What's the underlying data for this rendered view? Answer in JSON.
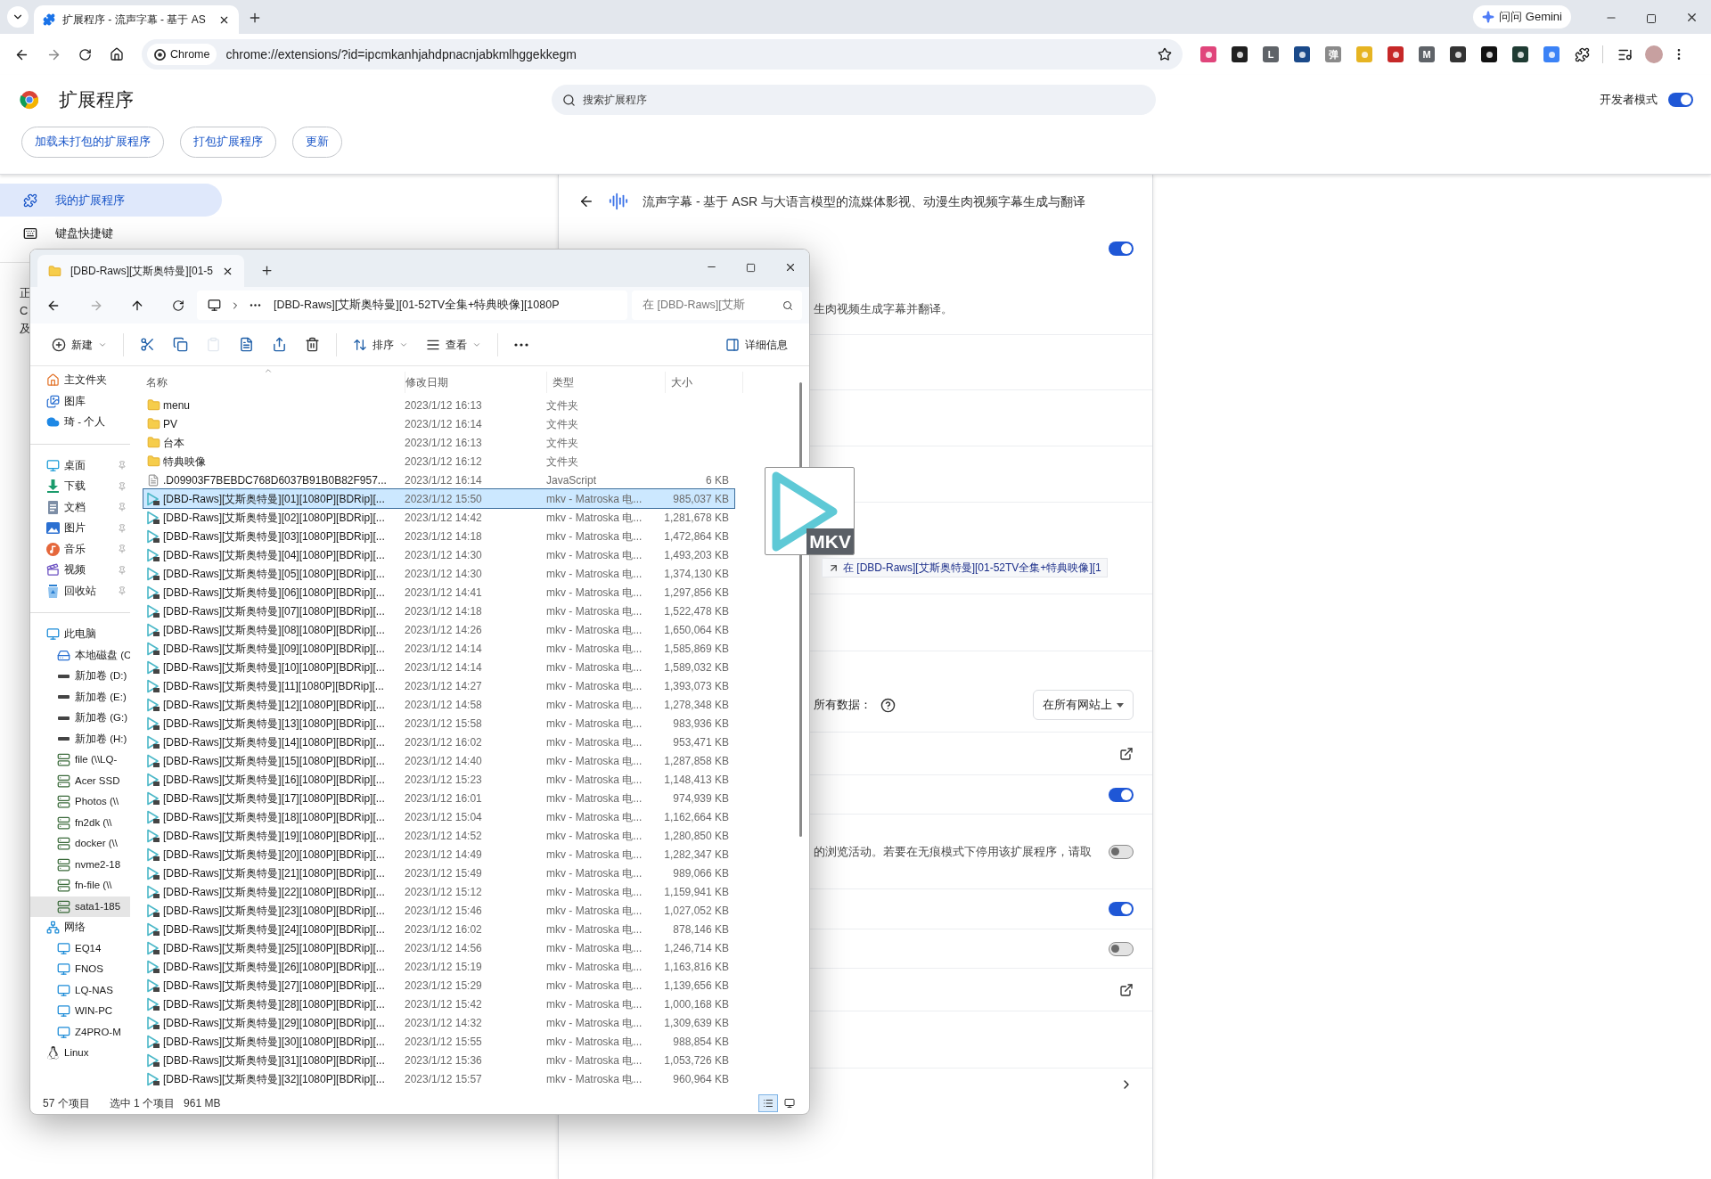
{
  "browser": {
    "tab_title": "扩展程序 - 流声字幕 - 基于 AS",
    "gemini_button": "问问 Gemini",
    "url_chip": "Chrome",
    "url": "chrome://extensions/?id=ipcmkanhjahdpnacnjabkmlhggekkegm",
    "extension_icons": [
      {
        "color": "#e0457b"
      },
      {
        "color": "#1f1f1f"
      },
      {
        "color": "#5f6368",
        "label": "L"
      },
      {
        "color": "#1b4a8a"
      },
      {
        "color": "#8a8a8a",
        "label": "弹"
      },
      {
        "color": "#e6b422"
      },
      {
        "color": "#c62828"
      },
      {
        "color": "#5f6368",
        "label": "M"
      },
      {
        "color": "#333333"
      },
      {
        "color": "#111111"
      },
      {
        "color": "#1f3b33"
      },
      {
        "color": "#3b82f6"
      }
    ]
  },
  "extensions_page": {
    "title": "扩展程序",
    "search_placeholder": "搜索扩展程序",
    "developer_mode": {
      "label": "开发者模式",
      "on": true
    },
    "actions": [
      "加载未打包的扩展程序",
      "打包扩展程序",
      "更新"
    ],
    "sidebar": [
      {
        "label": "我的扩展程序",
        "selected": true
      },
      {
        "label": "键盘快捷键",
        "selected": false
      }
    ],
    "sidebar_fragments": [
      "正",
      "C",
      "及"
    ],
    "detail": {
      "title": "流声字幕 - 基于 ASR 与大语言模型的流媒体影视、动漫生肉视频字幕生成与翻译",
      "rows": [
        {
          "kind": "toggle_desc",
          "on": true,
          "text": "生肉视频生成字幕并翻译。"
        },
        {
          "kind": "blank"
        },
        {
          "kind": "blank"
        },
        {
          "kind": "blank"
        },
        {
          "kind": "blank"
        },
        {
          "kind": "blank"
        },
        {
          "kind": "site_access",
          "text": "所有数据：",
          "dropdown": "在所有网站上"
        },
        {
          "kind": "link"
        },
        {
          "kind": "toggle",
          "on": true
        },
        {
          "kind": "toggle_text",
          "on": false,
          "text": "的浏览活动。若要在无痕模式下停用该扩展程序，请取"
        },
        {
          "kind": "toggle",
          "on": true
        },
        {
          "kind": "toggle",
          "on": false
        },
        {
          "kind": "link"
        },
        {
          "kind": "blank"
        },
        {
          "kind": "chevron"
        }
      ]
    }
  },
  "drag_preview": {
    "label": "MKV",
    "tooltip": "在 [DBD-Raws][艾斯奥特曼][01-52TV全集+特典映像][1"
  },
  "explorer": {
    "tab_title": "[DBD-Raws][艾斯奥特曼][01-5",
    "path": "[DBD-Raws][艾斯奥特曼][01-52TV全集+特典映像][1080P",
    "search_placeholder": "在 [DBD-Raws][艾斯",
    "commands": [
      {
        "kind": "new",
        "label": "新建",
        "disabled": false
      },
      {
        "kind": "cut",
        "disabled": false
      },
      {
        "kind": "copy",
        "disabled": false
      },
      {
        "kind": "paste",
        "disabled": true
      },
      {
        "kind": "rename",
        "disabled": false
      },
      {
        "kind": "share",
        "disabled": false
      },
      {
        "kind": "delete",
        "disabled": false
      },
      {
        "kind": "sort",
        "label": "排序",
        "disabled": false
      },
      {
        "kind": "view",
        "label": "查看",
        "disabled": false
      },
      {
        "kind": "more",
        "disabled": false
      },
      {
        "kind": "details",
        "label": "详细信息",
        "disabled": false
      }
    ],
    "nav_groups": [
      [
        {
          "label": "主文件夹",
          "kind": "home",
          "selected": false
        },
        {
          "label": "图库",
          "kind": "gallery",
          "selected": false
        },
        {
          "label": "琦 - 个人",
          "kind": "cloud",
          "selected": false
        }
      ],
      [
        {
          "label": "桌面",
          "kind": "desktop",
          "pinned": true,
          "selected": false
        },
        {
          "label": "下载",
          "kind": "download",
          "pinned": true,
          "selected": false
        },
        {
          "label": "文档",
          "kind": "documents",
          "pinned": true,
          "selected": false
        },
        {
          "label": "图片",
          "kind": "pictures",
          "pinned": true,
          "selected": false
        },
        {
          "label": "音乐",
          "kind": "music",
          "pinned": true,
          "selected": false
        },
        {
          "label": "视频",
          "kind": "videos",
          "pinned": true,
          "selected": false
        },
        {
          "label": "回收站",
          "kind": "recycle",
          "pinned": true,
          "selected": false
        }
      ],
      [
        {
          "label": "此电脑",
          "kind": "pc",
          "selected": false,
          "children": [
            {
              "label": "本地磁盘 (C",
              "kind": "local-disk",
              "selected": false
            },
            {
              "label": "新加卷 (D:)",
              "kind": "drive",
              "selected": false
            },
            {
              "label": "新加卷 (E:)",
              "kind": "drive",
              "selected": false
            },
            {
              "label": "新加卷 (G:)",
              "kind": "drive",
              "selected": false
            },
            {
              "label": "新加卷 (H:)",
              "kind": "drive",
              "selected": false
            },
            {
              "label": "file (\\\\LQ-",
              "kind": "network-drive",
              "selected": false
            },
            {
              "label": "Acer SSD",
              "kind": "network-drive",
              "selected": false
            },
            {
              "label": "Photos (\\\\",
              "kind": "network-drive",
              "selected": false
            },
            {
              "label": "fn2dk (\\\\",
              "kind": "network-drive",
              "selected": false
            },
            {
              "label": "docker (\\\\",
              "kind": "network-drive",
              "selected": false
            },
            {
              "label": "nvme2-18",
              "kind": "network-drive",
              "selected": false
            },
            {
              "label": "fn-file (\\\\",
              "kind": "network-drive",
              "selected": false
            },
            {
              "label": "sata1-185",
              "kind": "network-drive",
              "selected": true
            }
          ]
        },
        {
          "label": "网络",
          "kind": "network",
          "selected": false,
          "children": [
            {
              "label": "EQ14",
              "kind": "computer",
              "selected": false
            },
            {
              "label": "FNOS",
              "kind": "computer",
              "selected": false
            },
            {
              "label": "LQ-NAS",
              "kind": "computer",
              "selected": false
            },
            {
              "label": "WIN-PC",
              "kind": "computer",
              "selected": false
            },
            {
              "label": "Z4PRO-M",
              "kind": "computer",
              "selected": false
            }
          ]
        },
        {
          "label": "Linux",
          "kind": "linux",
          "selected": false
        }
      ]
    ],
    "columns": [
      "名称",
      "修改日期",
      "类型",
      "大小"
    ],
    "files": [
      {
        "name": "menu",
        "date": "2023/1/12 16:13",
        "type": "文件夹",
        "kind": "folder",
        "selected": false
      },
      {
        "name": "PV",
        "date": "2023/1/12 16:14",
        "type": "文件夹",
        "kind": "folder",
        "selected": false
      },
      {
        "name": "台本",
        "date": "2023/1/12 16:13",
        "type": "文件夹",
        "kind": "folder",
        "selected": false
      },
      {
        "name": "特典映像",
        "date": "2023/1/12 16:12",
        "type": "文件夹",
        "kind": "folder",
        "selected": false
      },
      {
        "name": ".D09903F7BEBDC768D6037B91B0B82F957...",
        "date": "2023/1/12 16:14",
        "type": "JavaScript",
        "size": "6 KB",
        "kind": "script",
        "selected": false
      },
      {
        "name": "[DBD-Raws][艾斯奥特曼][01][1080P][BDRip][...",
        "date": "2023/1/12 15:50",
        "type": "mkv - Matroska 电...",
        "size": "985,037 KB",
        "kind": "video",
        "selected": true
      },
      {
        "name": "[DBD-Raws][艾斯奥特曼][02][1080P][BDRip][...",
        "date": "2023/1/12 14:42",
        "type": "mkv - Matroska 电...",
        "size": "1,281,678 KB",
        "kind": "video",
        "selected": false
      },
      {
        "name": "[DBD-Raws][艾斯奥特曼][03][1080P][BDRip][...",
        "date": "2023/1/12 14:18",
        "type": "mkv - Matroska 电...",
        "size": "1,472,864 KB",
        "kind": "video",
        "selected": false
      },
      {
        "name": "[DBD-Raws][艾斯奥特曼][04][1080P][BDRip][...",
        "date": "2023/1/12 14:30",
        "type": "mkv - Matroska 电...",
        "size": "1,493,203 KB",
        "kind": "video",
        "selected": false
      },
      {
        "name": "[DBD-Raws][艾斯奥特曼][05][1080P][BDRip][...",
        "date": "2023/1/12 14:30",
        "type": "mkv - Matroska 电...",
        "size": "1,374,130 KB",
        "kind": "video",
        "selected": false
      },
      {
        "name": "[DBD-Raws][艾斯奥特曼][06][1080P][BDRip][...",
        "date": "2023/1/12 14:41",
        "type": "mkv - Matroska 电...",
        "size": "1,297,856 KB",
        "kind": "video",
        "selected": false
      },
      {
        "name": "[DBD-Raws][艾斯奥特曼][07][1080P][BDRip][...",
        "date": "2023/1/12 14:18",
        "type": "mkv - Matroska 电...",
        "size": "1,522,478 KB",
        "kind": "video",
        "selected": false
      },
      {
        "name": "[DBD-Raws][艾斯奥特曼][08][1080P][BDRip][...",
        "date": "2023/1/12 14:26",
        "type": "mkv - Matroska 电...",
        "size": "1,650,064 KB",
        "kind": "video",
        "selected": false
      },
      {
        "name": "[DBD-Raws][艾斯奥特曼][09][1080P][BDRip][...",
        "date": "2023/1/12 14:14",
        "type": "mkv - Matroska 电...",
        "size": "1,585,869 KB",
        "kind": "video",
        "selected": false
      },
      {
        "name": "[DBD-Raws][艾斯奥特曼][10][1080P][BDRip][...",
        "date": "2023/1/12 14:14",
        "type": "mkv - Matroska 电...",
        "size": "1,589,032 KB",
        "kind": "video",
        "selected": false
      },
      {
        "name": "[DBD-Raws][艾斯奥特曼][11][1080P][BDRip][...",
        "date": "2023/1/12 14:27",
        "type": "mkv - Matroska 电...",
        "size": "1,393,073 KB",
        "kind": "video",
        "selected": false
      },
      {
        "name": "[DBD-Raws][艾斯奥特曼][12][1080P][BDRip][...",
        "date": "2023/1/12 14:58",
        "type": "mkv - Matroska 电...",
        "size": "1,278,348 KB",
        "kind": "video",
        "selected": false
      },
      {
        "name": "[DBD-Raws][艾斯奥特曼][13][1080P][BDRip][...",
        "date": "2023/1/12 15:58",
        "type": "mkv - Matroska 电...",
        "size": "983,936 KB",
        "kind": "video",
        "selected": false
      },
      {
        "name": "[DBD-Raws][艾斯奥特曼][14][1080P][BDRip][...",
        "date": "2023/1/12 16:02",
        "type": "mkv - Matroska 电...",
        "size": "953,471 KB",
        "kind": "video",
        "selected": false
      },
      {
        "name": "[DBD-Raws][艾斯奥特曼][15][1080P][BDRip][...",
        "date": "2023/1/12 14:40",
        "type": "mkv - Matroska 电...",
        "size": "1,287,858 KB",
        "kind": "video",
        "selected": false
      },
      {
        "name": "[DBD-Raws][艾斯奥特曼][16][1080P][BDRip][...",
        "date": "2023/1/12 15:23",
        "type": "mkv - Matroska 电...",
        "size": "1,148,413 KB",
        "kind": "video",
        "selected": false
      },
      {
        "name": "[DBD-Raws][艾斯奥特曼][17][1080P][BDRip][...",
        "date": "2023/1/12 16:01",
        "type": "mkv - Matroska 电...",
        "size": "974,939 KB",
        "kind": "video",
        "selected": false
      },
      {
        "name": "[DBD-Raws][艾斯奥特曼][18][1080P][BDRip][...",
        "date": "2023/1/12 15:04",
        "type": "mkv - Matroska 电...",
        "size": "1,162,664 KB",
        "kind": "video",
        "selected": false
      },
      {
        "name": "[DBD-Raws][艾斯奥特曼][19][1080P][BDRip][...",
        "date": "2023/1/12 14:52",
        "type": "mkv - Matroska 电...",
        "size": "1,280,850 KB",
        "kind": "video",
        "selected": false
      },
      {
        "name": "[DBD-Raws][艾斯奥特曼][20][1080P][BDRip][...",
        "date": "2023/1/12 14:49",
        "type": "mkv - Matroska 电...",
        "size": "1,282,347 KB",
        "kind": "video",
        "selected": false
      },
      {
        "name": "[DBD-Raws][艾斯奥特曼][21][1080P][BDRip][...",
        "date": "2023/1/12 15:49",
        "type": "mkv - Matroska 电...",
        "size": "989,066 KB",
        "kind": "video",
        "selected": false
      },
      {
        "name": "[DBD-Raws][艾斯奥特曼][22][1080P][BDRip][...",
        "date": "2023/1/12 15:12",
        "type": "mkv - Matroska 电...",
        "size": "1,159,941 KB",
        "kind": "video",
        "selected": false
      },
      {
        "name": "[DBD-Raws][艾斯奥特曼][23][1080P][BDRip][...",
        "date": "2023/1/12 15:46",
        "type": "mkv - Matroska 电...",
        "size": "1,027,052 KB",
        "kind": "video",
        "selected": false
      },
      {
        "name": "[DBD-Raws][艾斯奥特曼][24][1080P][BDRip][...",
        "date": "2023/1/12 16:02",
        "type": "mkv - Matroska 电...",
        "size": "878,146 KB",
        "kind": "video",
        "selected": false
      },
      {
        "name": "[DBD-Raws][艾斯奥特曼][25][1080P][BDRip][...",
        "date": "2023/1/12 14:56",
        "type": "mkv - Matroska 电...",
        "size": "1,246,714 KB",
        "kind": "video",
        "selected": false
      },
      {
        "name": "[DBD-Raws][艾斯奥特曼][26][1080P][BDRip][...",
        "date": "2023/1/12 15:19",
        "type": "mkv - Matroska 电...",
        "size": "1,163,816 KB",
        "kind": "video",
        "selected": false
      },
      {
        "name": "[DBD-Raws][艾斯奥特曼][27][1080P][BDRip][...",
        "date": "2023/1/12 15:29",
        "type": "mkv - Matroska 电...",
        "size": "1,139,656 KB",
        "kind": "video",
        "selected": false
      },
      {
        "name": "[DBD-Raws][艾斯奥特曼][28][1080P][BDRip][...",
        "date": "2023/1/12 15:42",
        "type": "mkv - Matroska 电...",
        "size": "1,000,168 KB",
        "kind": "video",
        "selected": false
      },
      {
        "name": "[DBD-Raws][艾斯奥特曼][29][1080P][BDRip][...",
        "date": "2023/1/12 14:32",
        "type": "mkv - Matroska 电...",
        "size": "1,309,639 KB",
        "kind": "video",
        "selected": false
      },
      {
        "name": "[DBD-Raws][艾斯奥特曼][30][1080P][BDRip][...",
        "date": "2023/1/12 15:55",
        "type": "mkv - Matroska 电...",
        "size": "988,854 KB",
        "kind": "video",
        "selected": false
      },
      {
        "name": "[DBD-Raws][艾斯奥特曼][31][1080P][BDRip][...",
        "date": "2023/1/12 15:36",
        "type": "mkv - Matroska 电...",
        "size": "1,053,726 KB",
        "kind": "video",
        "selected": false
      },
      {
        "name": "[DBD-Raws][艾斯奥特曼][32][1080P][BDRip][...",
        "date": "2023/1/12 15:57",
        "type": "mkv - Matroska 电...",
        "size": "960,964 KB",
        "kind": "video",
        "selected": false
      }
    ],
    "status_count": "57 个项目",
    "status_selection": "选中 1 个项目",
    "status_size": "961 MB"
  }
}
